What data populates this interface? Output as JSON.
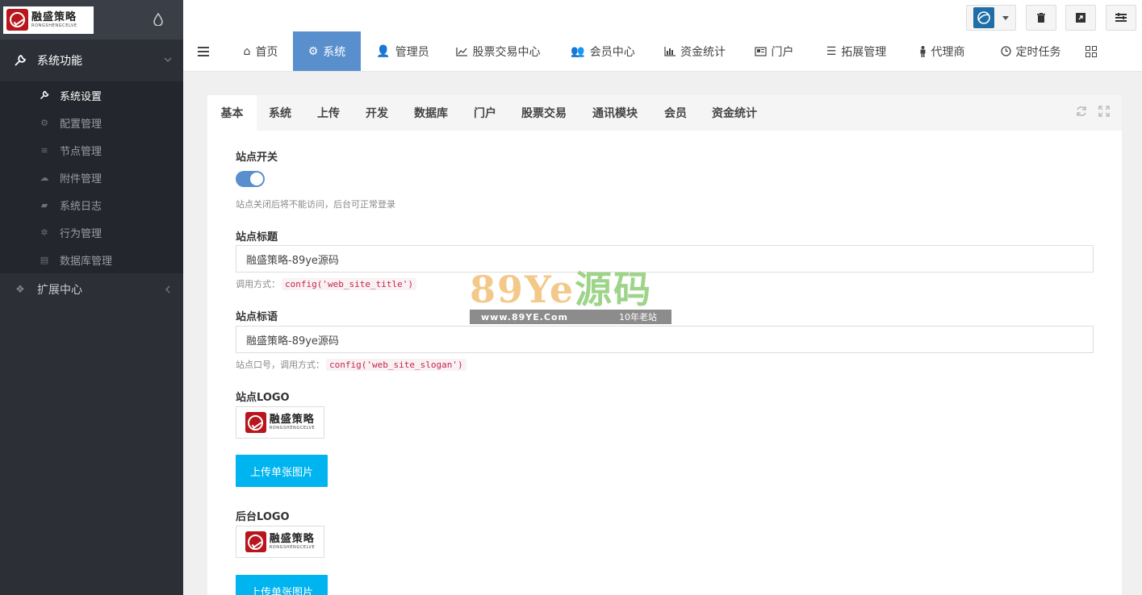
{
  "brand": {
    "logo_cn": "融盛策略",
    "logo_en": "RONGSHENGCELVE"
  },
  "sidebar": {
    "section_label": "系统功能",
    "items": [
      {
        "label": "系统设置",
        "icon": "wrench-icon"
      },
      {
        "label": "配置管理",
        "icon": "cogs-icon"
      },
      {
        "label": "节点管理",
        "icon": "list-icon"
      },
      {
        "label": "附件管理",
        "icon": "cloud-upload-icon"
      },
      {
        "label": "系统日志",
        "icon": "book-icon"
      },
      {
        "label": "行为管理",
        "icon": "bug-icon"
      },
      {
        "label": "数据库管理",
        "icon": "database-icon"
      }
    ],
    "ext_label": "扩展中心"
  },
  "nav": {
    "items": [
      {
        "label": "首页",
        "icon": "home-icon"
      },
      {
        "label": "系统",
        "icon": "gear-icon"
      },
      {
        "label": "管理员",
        "icon": "user-icon"
      },
      {
        "label": "股票交易中心",
        "icon": "line-chart-icon"
      },
      {
        "label": "会员中心",
        "icon": "users-icon"
      },
      {
        "label": "资金统计",
        "icon": "bar-chart-icon"
      },
      {
        "label": "门户",
        "icon": "newspaper-icon"
      },
      {
        "label": "拓展管理",
        "icon": "list-icon"
      },
      {
        "label": "代理商",
        "icon": "male-icon"
      },
      {
        "label": "定时任务",
        "icon": "clock-icon"
      }
    ]
  },
  "tabs": [
    "基本",
    "系统",
    "上传",
    "开发",
    "数据库",
    "门户",
    "股票交易",
    "通讯模块",
    "会员",
    "资金统计"
  ],
  "form": {
    "site_switch_label": "站点开关",
    "site_switch_on": true,
    "site_switch_help": "站点关闭后将不能访问，后台可正常登录",
    "site_title_label": "站点标题",
    "site_title_value": "融盛策略-89ye源码",
    "site_title_help": "调用方式：",
    "site_title_code": "config('web_site_title')",
    "site_slogan_label": "站点标语",
    "site_slogan_value": "融盛策略-89ye源码",
    "site_slogan_help": "站点口号，调用方式：",
    "site_slogan_code": "config('web_site_slogan')",
    "site_logo_label": "站点LOGO",
    "upload_label": "上传单张图片",
    "admin_logo_label": "后台LOGO"
  },
  "watermark": {
    "big_a": "89Ye",
    "big_b": "源码",
    "url": "www.89YE.Com",
    "tag": "10年老站"
  },
  "colors": {
    "sidebar_bg": "#2c2f36",
    "accent": "#5a8fce",
    "upload": "#00b4f0"
  }
}
